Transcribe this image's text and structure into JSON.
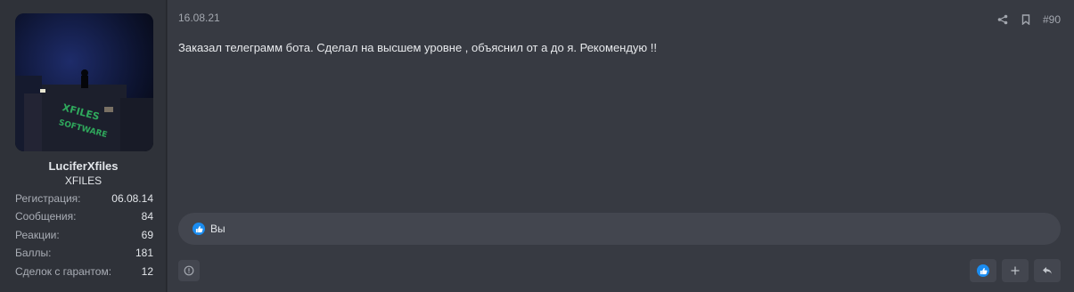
{
  "user": {
    "name": "LuciferXfiles",
    "title": "XFILES",
    "avatar_text": [
      "XFILES",
      "SOFTWARE"
    ],
    "stats": [
      {
        "label": "Регистрация:",
        "value": "06.08.14"
      },
      {
        "label": "Сообщения:",
        "value": "84"
      },
      {
        "label": "Реакции:",
        "value": "69"
      },
      {
        "label": "Баллы:",
        "value": "181"
      },
      {
        "label": "Сделок с гарантом:",
        "value": "12"
      }
    ]
  },
  "post": {
    "date": "16.08.21",
    "number": "#90",
    "message": "Заказал телеграмм бота. Сделал на высшем уровне , объяснил от а до я. Рекомендую !!",
    "reactions_text": "Вы"
  },
  "icons": {
    "share": "share-icon",
    "bookmark": "bookmark-icon",
    "report": "report-icon",
    "like": "like-icon",
    "add": "plus-icon",
    "reply": "reply-icon"
  },
  "colors": {
    "accent": "#1a8cf0",
    "background": "#373a42",
    "panel": "#2f3239"
  }
}
